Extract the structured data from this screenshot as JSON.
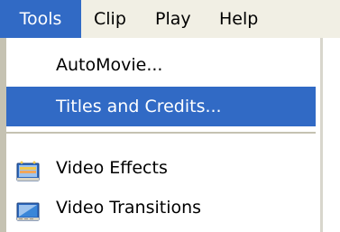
{
  "menubar": {
    "items": [
      {
        "label": "Tools",
        "active": true
      },
      {
        "label": "Clip",
        "active": false
      },
      {
        "label": "Play",
        "active": false
      },
      {
        "label": "Help",
        "active": false
      }
    ]
  },
  "dropdown": {
    "items": [
      {
        "label": "AutoMovie...",
        "highlighted": false
      },
      {
        "label": "Titles and Credits...",
        "highlighted": true
      },
      {
        "label": "Video Effects",
        "icon": "video-effects-icon",
        "highlighted": false
      },
      {
        "label": "Video Transitions",
        "icon": "video-transitions-icon",
        "highlighted": false
      }
    ]
  },
  "colors": {
    "highlight": "#316ac5",
    "menubar_bg": "#f1efe4",
    "menu_border": "#c5c2b2"
  }
}
